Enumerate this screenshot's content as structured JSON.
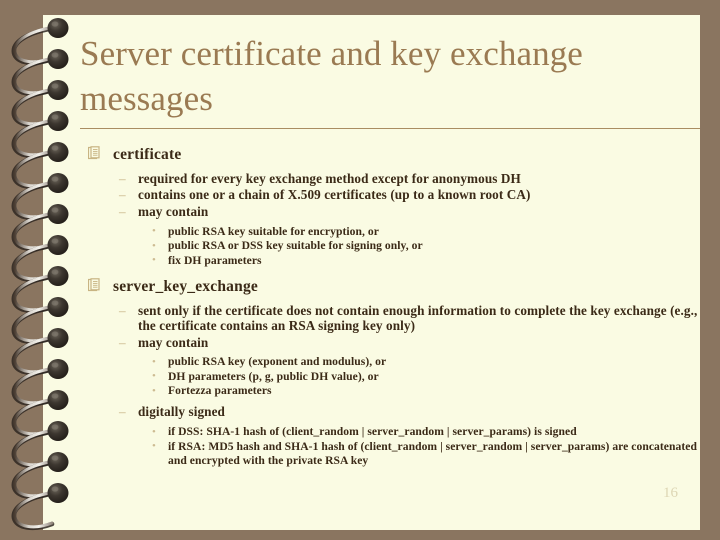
{
  "slide": {
    "title": "Server certificate and key exchange messages",
    "page_number": "16",
    "colors": {
      "background": "#8a7560",
      "page": "#fafbe3",
      "title_text": "#9a7a52",
      "body_text": "#3b2a17",
      "bullet_marker": "#c6b184",
      "page_number_text": "#ddd6b4",
      "rule": "#a98d62"
    },
    "bullet_icons": {
      "level1": "pages-document-icon",
      "level2": "en-dash-marker",
      "level3": "small-dot-marker"
    },
    "markers": {
      "level2": "–",
      "level3": "•"
    }
  },
  "outline": [
    {
      "level": 1,
      "text": "certificate"
    },
    {
      "level": 2,
      "text": "required for every key exchange method except for anonymous DH"
    },
    {
      "level": 2,
      "text": "contains one or a chain of X.509 certificates (up to a known root CA)"
    },
    {
      "level": 2,
      "text": "may contain"
    },
    {
      "level": 3,
      "text": "public RSA key suitable for encryption, or"
    },
    {
      "level": 3,
      "text": "public RSA or DSS key suitable for signing only, or"
    },
    {
      "level": 3,
      "text": "fix DH parameters"
    },
    {
      "level": 1,
      "text": "server_key_exchange"
    },
    {
      "level": 2,
      "text": "sent only if the certificate does not contain enough information to complete the key exchange (e.g., the certificate contains an RSA signing key only)"
    },
    {
      "level": 2,
      "text": "may contain"
    },
    {
      "level": 3,
      "text": "public RSA key (exponent and modulus), or"
    },
    {
      "level": 3,
      "text": "DH parameters (p, g, public DH value), or"
    },
    {
      "level": 3,
      "text": "Fortezza parameters"
    },
    {
      "level": 2,
      "text": "digitally signed"
    },
    {
      "level": 3,
      "text": "if DSS: SHA-1 hash of (client_random | server_random | server_params) is signed"
    },
    {
      "level": 3,
      "text": "if RSA: MD5 hash and SHA-1 hash of (client_random | server_random | server_params) are concatenated and encrypted with the private RSA key"
    }
  ]
}
